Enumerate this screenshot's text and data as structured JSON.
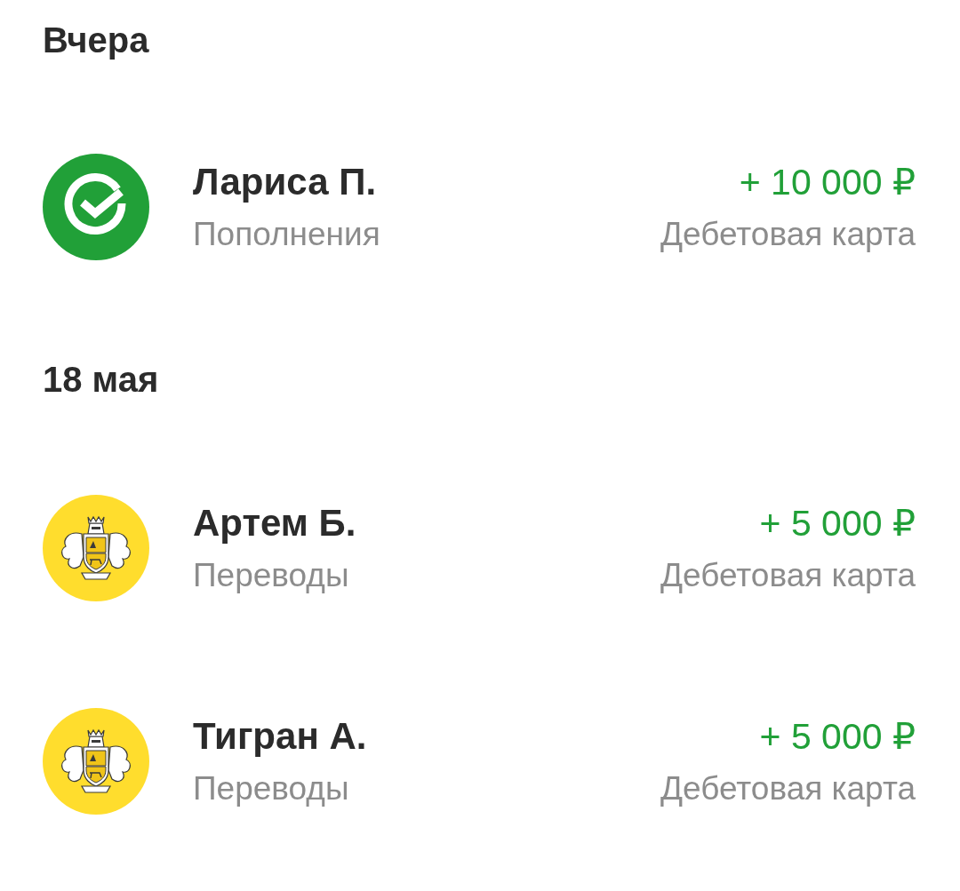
{
  "sections": [
    {
      "heading": "Вчера",
      "transactions": [
        {
          "kind": "check",
          "color": "#21a038",
          "name": "Лариса П.",
          "category": "Пополнения",
          "amount": "+ 10 000 ₽",
          "account": "Дебетовая карта"
        }
      ]
    },
    {
      "heading": "18 мая",
      "transactions": [
        {
          "kind": "crest",
          "color": "#ffdd2d",
          "name": "Артем Б.",
          "category": "Переводы",
          "amount": "+ 5 000 ₽",
          "account": "Дебетовая карта"
        },
        {
          "kind": "crest",
          "color": "#ffdd2d",
          "name": "Тигран А.",
          "category": "Переводы",
          "amount": "+ 5 000 ₽",
          "account": "Дебетовая карта"
        }
      ]
    }
  ]
}
